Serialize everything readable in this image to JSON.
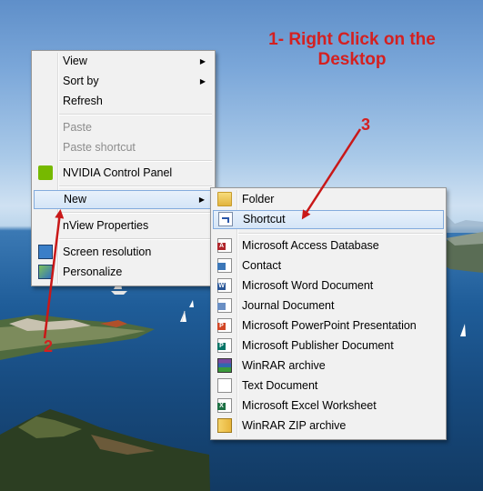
{
  "annotations": {
    "step1_line1": "1- Right Click on the",
    "step1_line2": "Desktop",
    "step2": "2",
    "step3": "3"
  },
  "context_menu": {
    "items": [
      {
        "label": "View",
        "has_submenu": true
      },
      {
        "label": "Sort by",
        "has_submenu": true
      },
      {
        "label": "Refresh"
      },
      {
        "label": "Paste",
        "disabled": true
      },
      {
        "label": "Paste shortcut",
        "disabled": true
      },
      {
        "label": "NVIDIA Control Panel",
        "icon": "nvidia-icon"
      },
      {
        "label": "New",
        "has_submenu": true,
        "highlighted": true
      },
      {
        "label": "nView Properties"
      },
      {
        "label": "Screen resolution",
        "icon": "monitor-icon"
      },
      {
        "label": "Personalize",
        "icon": "personalize-icon"
      }
    ]
  },
  "new_submenu": {
    "items": [
      {
        "label": "Folder",
        "icon": "folder-icon"
      },
      {
        "label": "Shortcut",
        "icon": "shortcut-icon",
        "highlighted": true
      },
      {
        "label": "Microsoft Access Database",
        "icon": "access-icon"
      },
      {
        "label": "Contact",
        "icon": "contact-icon"
      },
      {
        "label": "Microsoft Word Document",
        "icon": "word-icon"
      },
      {
        "label": "Journal Document",
        "icon": "journal-icon"
      },
      {
        "label": "Microsoft PowerPoint Presentation",
        "icon": "powerpoint-icon"
      },
      {
        "label": "Microsoft Publisher Document",
        "icon": "publisher-icon"
      },
      {
        "label": "WinRAR archive",
        "icon": "winrar-icon"
      },
      {
        "label": "Text Document",
        "icon": "text-document-icon"
      },
      {
        "label": "Microsoft Excel Worksheet",
        "icon": "excel-icon"
      },
      {
        "label": "WinRAR ZIP archive",
        "icon": "zip-icon"
      }
    ]
  },
  "colors": {
    "annotation": "#d42020",
    "highlight_border": "#84acdd",
    "menu_background": "#f1f1f1"
  }
}
